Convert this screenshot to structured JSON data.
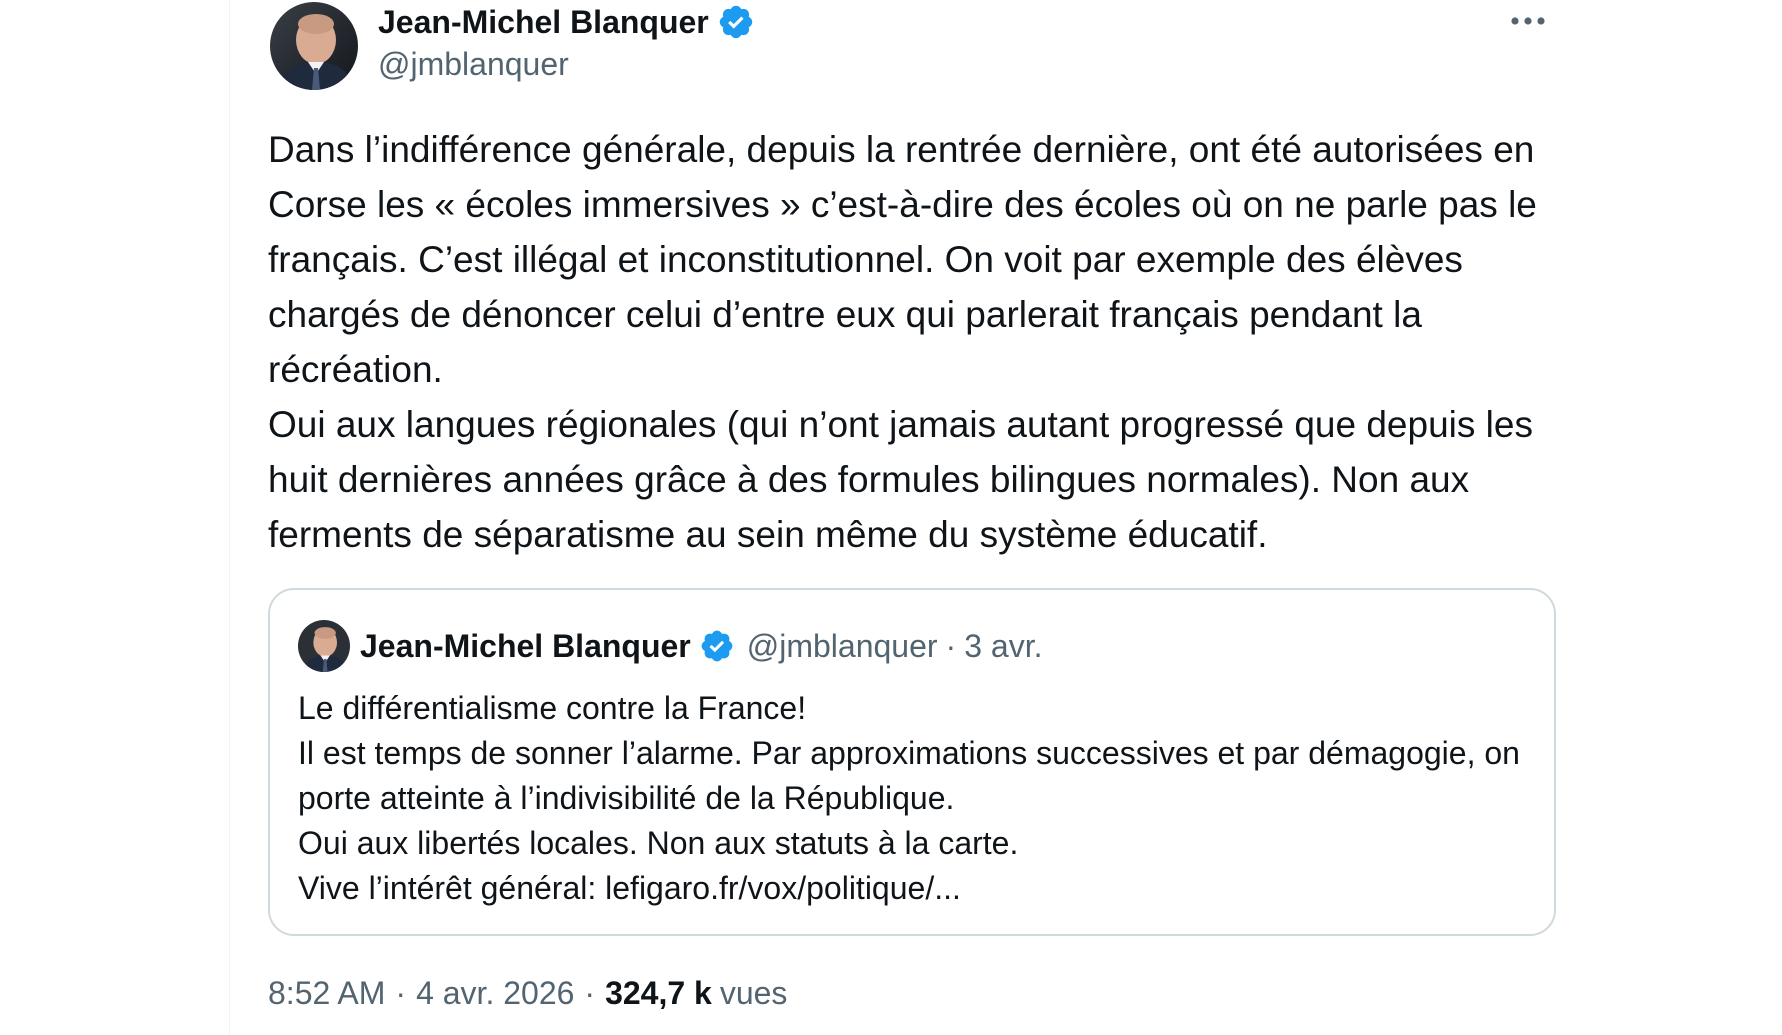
{
  "tweet": {
    "author": {
      "display_name": "Jean-Michel Blanquer",
      "handle": "@jmblanquer",
      "verified": true
    },
    "more_icon": "more-horizontal-icon",
    "body": [
      "Dans l’indifférence générale, depuis la rentrée dernière, ont été autorisées en Corse les « écoles immersives » c’est-à-dire des écoles où on ne parle pas le français. C’est illégal et inconstitutionnel. On voit par exemple des élèves chargés de dénoncer celui d’entre eux qui parlerait français pendant la récréation.",
      "Oui aux langues régionales (qui n’ont jamais autant progressé que depuis les huit dernières années grâce à des formules bilingues normales). Non aux ferments de séparatisme au sein même du système éducatif."
    ],
    "quote": {
      "display_name": "Jean-Michel Blanquer",
      "handle": "@jmblanquer",
      "dot": "·",
      "date": "3 avr.",
      "lines": [
        "Le différentialisme contre la France!",
        "Il est temps de sonner l’alarme. Par approximations successives et par démagogie, on porte atteinte à l’indivisibilité de la République.",
        "Oui aux libertés locales. Non aux statuts à la carte.",
        "Vive l’intérêt général: lefigaro.fr/vox/politique/..."
      ]
    },
    "meta": {
      "time": "8:52 AM",
      "separator": "·",
      "date": "4 avr. 2026",
      "views_count": "324,7 k",
      "views_label": "vues"
    },
    "colors": {
      "verified_blue": "#1d9bf0",
      "secondary_text": "#536471",
      "border": "#cfd9de"
    }
  }
}
